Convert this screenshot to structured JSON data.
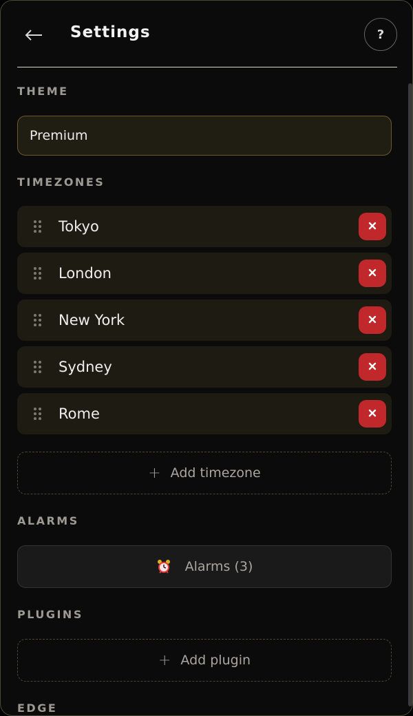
{
  "header": {
    "title": "Settings",
    "help_label": "?"
  },
  "theme": {
    "section_label": "THEME",
    "value": "Premium"
  },
  "timezones": {
    "section_label": "TIMEZONES",
    "items": [
      {
        "label": "Tokyo"
      },
      {
        "label": "London"
      },
      {
        "label": "New York"
      },
      {
        "label": "Sydney"
      },
      {
        "label": "Rome"
      }
    ],
    "add_label": "Add timezone",
    "add_icon": "+"
  },
  "alarms": {
    "section_label": "ALARMS",
    "button_label": "Alarms (3)",
    "icon": "alarm-clock-icon"
  },
  "plugins": {
    "section_label": "PLUGINS",
    "add_label": "Add plugin",
    "add_icon": "+"
  },
  "edge": {
    "section_label": "EDGE"
  },
  "colors": {
    "background": "#0b0b0b",
    "remove_button": "#c0282b",
    "row_background": "#1e1b12",
    "accent_border": "#6b5a2e"
  }
}
